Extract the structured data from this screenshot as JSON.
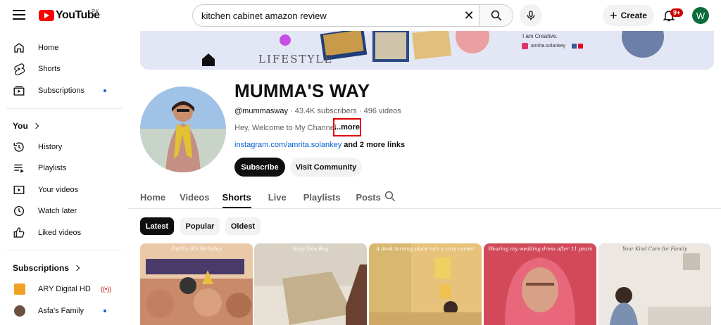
{
  "header": {
    "logo_text": "YouTube",
    "region": "PK",
    "search_value": "kitchen cabinet amazon review",
    "create_label": "Create",
    "notif_count": "9+",
    "user_initial": "W"
  },
  "sidebar": {
    "main": [
      {
        "label": "Home",
        "icon": "home-icon"
      },
      {
        "label": "Shorts",
        "icon": "shorts-icon"
      },
      {
        "label": "Subscriptions",
        "icon": "subscriptions-icon"
      }
    ],
    "you_title": "You",
    "you_items": [
      {
        "label": "History",
        "icon": "history-icon"
      },
      {
        "label": "Playlists",
        "icon": "playlists-icon"
      },
      {
        "label": "Your videos",
        "icon": "your-videos-icon"
      },
      {
        "label": "Watch later",
        "icon": "watch-later-icon"
      },
      {
        "label": "Liked videos",
        "icon": "liked-videos-icon"
      }
    ],
    "subscriptions_title": "Subscriptions",
    "subscriptions": [
      {
        "label": "ARY Digital HD"
      },
      {
        "label": "Asfa's Family"
      }
    ]
  },
  "banner": {
    "lifestyle_text": "LIFESTYLE",
    "creative_text": "I am Creative.",
    "handle_text": "amrita.solankey"
  },
  "channel": {
    "name": "MUMMA'S WAY",
    "handle": "@mummasway",
    "subscribers": "43.4K subscribers",
    "videos": "496 videos",
    "description": "Hey, Welcome to My Channel",
    "more_label": "...more",
    "link": "instagram.com/amrita.solankey",
    "more_links": "and 2 more links",
    "subscribe_label": "Subscribe",
    "community_label": "Visit Community"
  },
  "tabs": [
    {
      "label": "Home",
      "active": false
    },
    {
      "label": "Videos",
      "active": false
    },
    {
      "label": "Shorts",
      "active": true
    },
    {
      "label": "Live",
      "active": false
    },
    {
      "label": "Playlists",
      "active": false
    },
    {
      "label": "Posts",
      "active": false
    }
  ],
  "chips": [
    {
      "label": "Latest",
      "active": true
    },
    {
      "label": "Popular",
      "active": false
    },
    {
      "label": "Oldest",
      "active": false
    }
  ],
  "thumbnails": [
    {
      "caption": "Parth's 6th Birthday",
      "color": "#c98a6a"
    },
    {
      "caption": "Easy Tote Bag",
      "color": "#d9d2c4"
    },
    {
      "caption": "A desk turning place into a cozy corner",
      "color": "#e6c27a"
    },
    {
      "caption": "Wearing my wedding dress after 11 years",
      "color": "#d24a5a"
    },
    {
      "caption": "Your Kind Care for Family",
      "color": "#ece7e1"
    }
  ],
  "colors": {
    "accent_red": "#ff0000",
    "link_blue": "#065fd4",
    "highlight_box": "#e00000"
  }
}
